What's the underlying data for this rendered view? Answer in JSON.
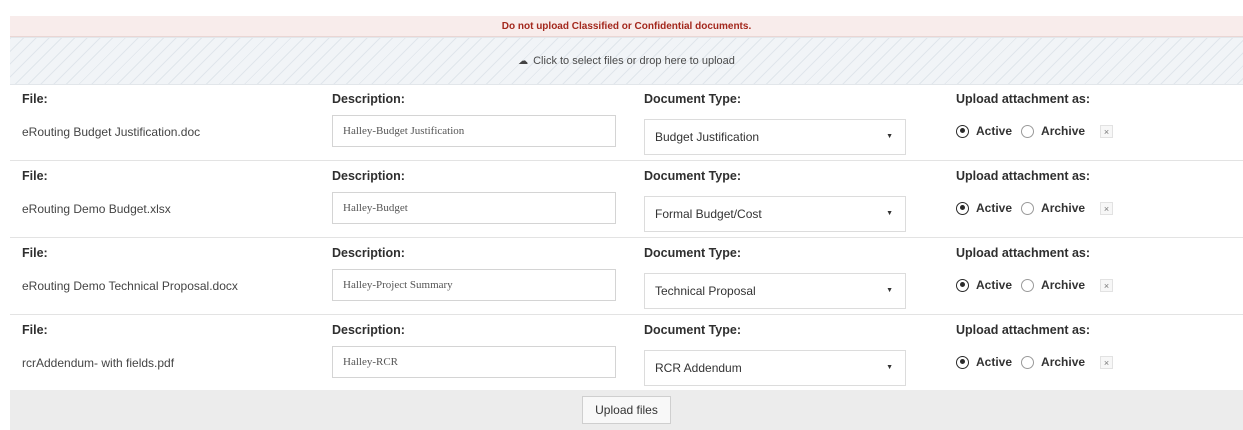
{
  "warning": "Do not upload Classified or Confidential documents.",
  "dropzone": {
    "icon": "cloud-upload-icon",
    "text": "Click to select files or drop here to upload"
  },
  "labels": {
    "file": "File:",
    "description": "Description:",
    "doc_type": "Document Type:",
    "upload_as": "Upload attachment as:",
    "active": "Active",
    "archive": "Archive",
    "remove": "×"
  },
  "files": [
    {
      "name": "eRouting Budget Justification.doc",
      "description": "Halley-Budget Justification",
      "doc_type": "Budget Justification",
      "upload_as": "Active"
    },
    {
      "name": "eRouting Demo Budget.xlsx",
      "description": "Halley-Budget",
      "doc_type": "Formal Budget/Cost",
      "upload_as": "Active"
    },
    {
      "name": "eRouting Demo Technical Proposal.docx",
      "description": "Halley-Project Summary",
      "doc_type": "Technical Proposal",
      "upload_as": "Active"
    },
    {
      "name": "rcrAddendum- with fields.pdf",
      "description": "Halley-RCR",
      "doc_type": "RCR Addendum",
      "upload_as": "Active"
    }
  ],
  "upload_button": "Upload files"
}
